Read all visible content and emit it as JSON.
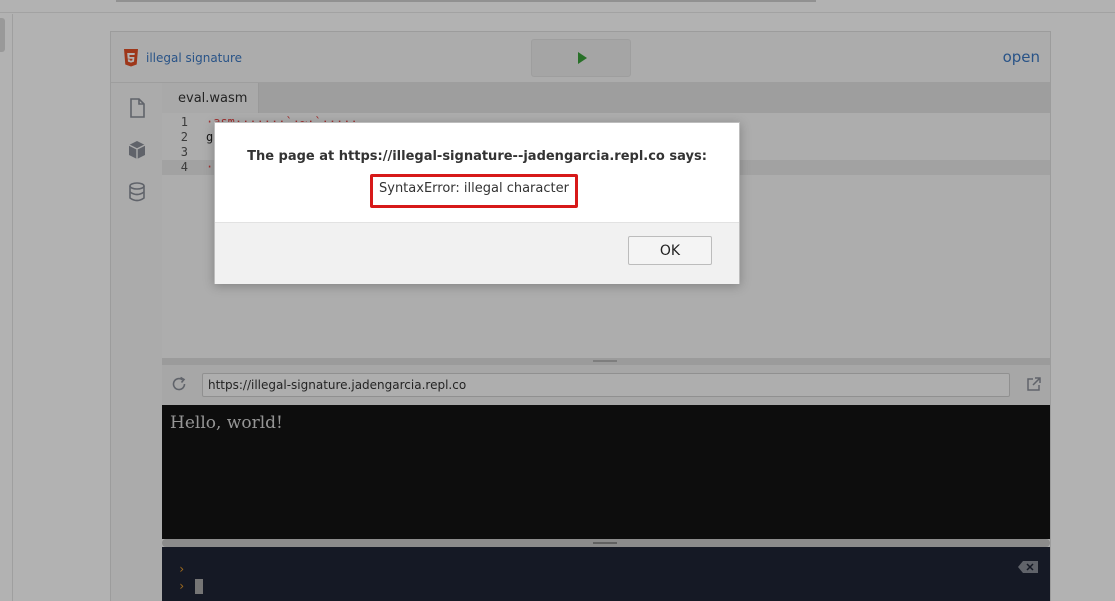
{
  "repl": {
    "name": "illegal signature",
    "open_label": "open",
    "file_tab": "eval.wasm",
    "code_lines": [
      {
        "num": "1",
        "text": "·asm·······`·~·`·····"
      },
      {
        "num": "2",
        "text": "g"
      },
      {
        "num": "3",
        "text": ""
      },
      {
        "num": "4",
        "text": "·"
      }
    ],
    "url": "https://illegal-signature.jadengarcia.repl.co",
    "output_text": "Hello, world!",
    "console_prompt": "›"
  },
  "dialog": {
    "title": "The page at https://illegal-signature--jadengarcia.repl.co says:",
    "message": "SyntaxError: illegal character",
    "ok_label": "OK"
  },
  "colors": {
    "accent": "#3b78c2",
    "run_green": "#3aa13a",
    "highlight_red": "#d71919"
  }
}
